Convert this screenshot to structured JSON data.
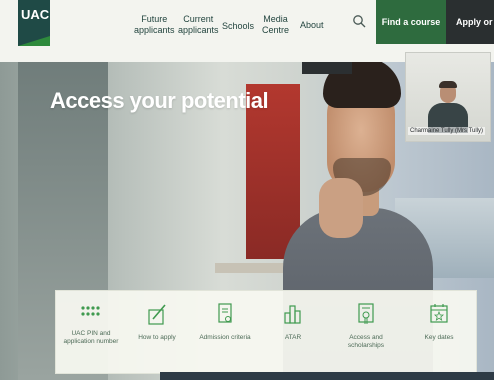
{
  "nav": {
    "logo": "UAC",
    "items": [
      {
        "line1": "Future",
        "line2": "applicants"
      },
      {
        "line1": "Current",
        "line2": "applicants"
      },
      {
        "line1": "Schools",
        "line2": ""
      },
      {
        "line1": "Media",
        "line2": "Centre"
      },
      {
        "line1": "About",
        "line2": ""
      }
    ],
    "find_course": "Find a course",
    "apply": "Apply or lo"
  },
  "hero": {
    "title": "Access your potential"
  },
  "video": {
    "name": "Charmaine Tully (Mrs Tully)"
  },
  "quick_links": [
    {
      "line1": "UAC PIN and",
      "line2": "application number",
      "icon": "pin-dots-icon"
    },
    {
      "line1": "How to apply",
      "line2": "",
      "icon": "pen-paper-icon"
    },
    {
      "line1": "Admission criteria",
      "line2": "",
      "icon": "document-icon"
    },
    {
      "line1": "ATAR",
      "line2": "",
      "icon": "bar-blocks-icon"
    },
    {
      "line1": "Access and",
      "line2": "scholarships",
      "icon": "certificate-icon"
    },
    {
      "line1": "Key dates",
      "line2": "",
      "icon": "calendar-icon"
    }
  ],
  "colors": {
    "brand_green": "#2e6b3e",
    "dark_teal": "#1f4a46",
    "link_green": "#4d6b57"
  }
}
